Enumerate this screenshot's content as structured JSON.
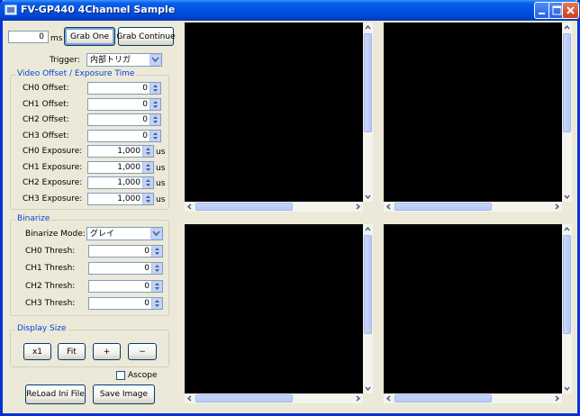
{
  "window": {
    "title": "FV-GP440 4Channel Sample"
  },
  "toolbar": {
    "elapsed_value": "0",
    "elapsed_unit": "ms",
    "grab_one_label": "Grab One",
    "grab_continue_label": "Grab Continue"
  },
  "trigger": {
    "label": "Trigger:",
    "value": "内部トリガ"
  },
  "video_group": {
    "title": "Video Offset / Exposure Time",
    "rows": [
      {
        "label": "CH0 Offset:",
        "value": "0",
        "unit": ""
      },
      {
        "label": "CH1 Offset:",
        "value": "0",
        "unit": ""
      },
      {
        "label": "CH2 Offset:",
        "value": "0",
        "unit": ""
      },
      {
        "label": "CH3 Offset:",
        "value": "0",
        "unit": ""
      },
      {
        "label": "CH0 Exposure:",
        "value": "1,000",
        "unit": "us"
      },
      {
        "label": "CH1 Exposure:",
        "value": "1,000",
        "unit": "us"
      },
      {
        "label": "CH2 Exposure:",
        "value": "1,000",
        "unit": "us"
      },
      {
        "label": "CH3 Exposure:",
        "value": "1,000",
        "unit": "us"
      }
    ]
  },
  "binarize_group": {
    "title": "Binarize",
    "mode_label": "Binarize Mode:",
    "mode_value": "グレイ",
    "rows": [
      {
        "label": "CH0 Thresh:",
        "value": "0"
      },
      {
        "label": "CH1 Thresh:",
        "value": "0"
      },
      {
        "label": "CH2 Thresh:",
        "value": "0"
      },
      {
        "label": "CH3 Thresh:",
        "value": "0"
      }
    ]
  },
  "display_group": {
    "title": "Display Size",
    "buttons": [
      "x1",
      "Fit",
      "+",
      "−"
    ]
  },
  "ascope": {
    "label": "Ascope",
    "checked": false
  },
  "footer": {
    "reload_label": "ReLoad Ini File",
    "save_label": "Save Image"
  },
  "icons": {
    "app": "app-icon",
    "minimize": "minimize-icon",
    "maximize": "maximize-icon",
    "close": "close-icon"
  },
  "colors": {
    "titlebar": "#0054E3",
    "group_title": "#0046D5",
    "viewer_bg": "#000000",
    "close_button": "#C8401F"
  }
}
